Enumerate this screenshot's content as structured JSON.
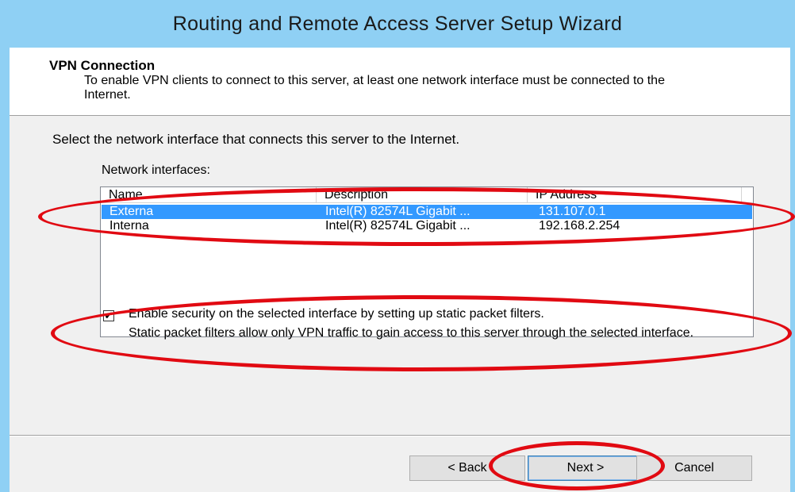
{
  "window": {
    "title": "Routing and Remote Access Server Setup Wizard"
  },
  "header": {
    "title": "VPN Connection",
    "description": "To enable VPN clients to connect to this server, at least one network interface must be connected to the Internet."
  },
  "content": {
    "instruction": "Select the network interface that connects this server to the Internet.",
    "list_label": "Network interfaces:",
    "columns": [
      "Name",
      "Description",
      "IP Address"
    ],
    "rows": [
      {
        "name": "Externa",
        "description": "Intel(R) 82574L Gigabit ...",
        "ip": "131.107.0.1",
        "selected": true
      },
      {
        "name": "Interna",
        "description": "Intel(R) 82574L Gigabit ...",
        "ip": "192.168.2.254",
        "selected": false
      }
    ],
    "security_checkbox": {
      "checked": true,
      "mark": "✔",
      "label": "Enable security on the selected interface by setting up static packet filters.",
      "description": "Static packet filters allow only VPN traffic to gain access to this server through the selected interface."
    }
  },
  "buttons": {
    "back": "< Back",
    "next": "Next >",
    "cancel": "Cancel"
  },
  "colors": {
    "title_bar": "#8fd0f4",
    "selection": "#3399ff",
    "annotation": "#e10a12"
  }
}
